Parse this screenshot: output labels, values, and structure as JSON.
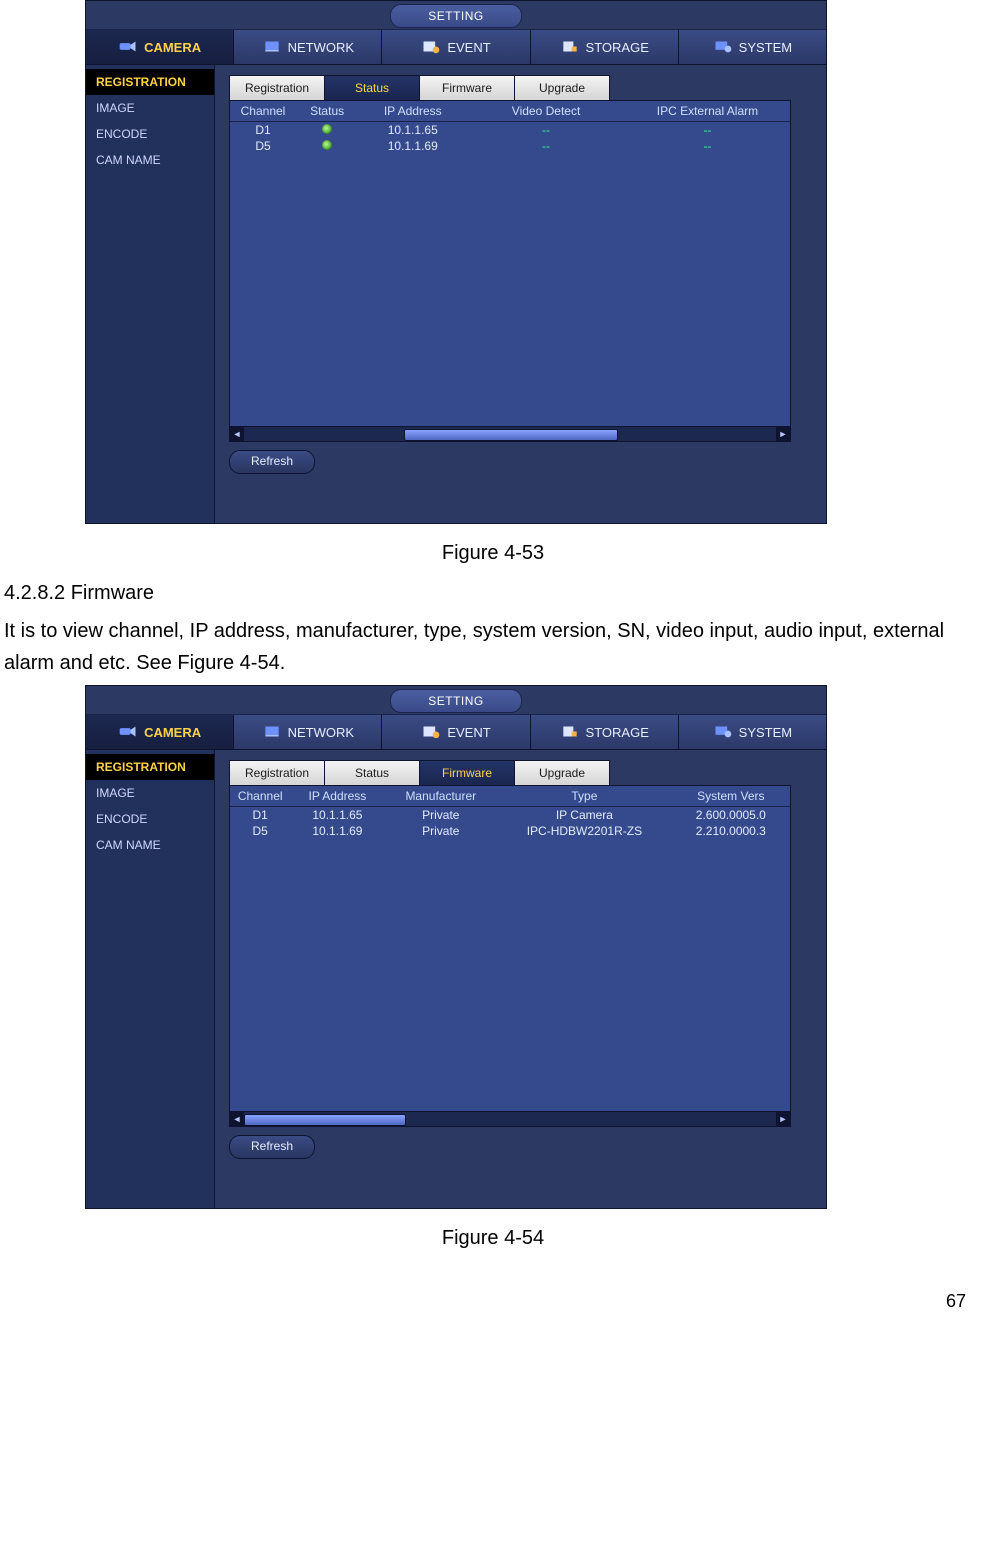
{
  "doc": {
    "fig53": "Figure 4-53",
    "sec_heading": "4.2.8.2 Firmware",
    "sec_body": "It is to view channel, IP address, manufacturer, type, system version, SN, video input, audio input, external alarm and etc. See Figure 4-54.",
    "fig54": "Figure 4-54",
    "pagenum": "67"
  },
  "ui": {
    "title": "SETTING",
    "toptabs": {
      "camera": "CAMERA",
      "network": "NETWORK",
      "event": "EVENT",
      "storage": "STORAGE",
      "system": "SYSTEM"
    },
    "sidebar": {
      "registration": "REGISTRATION",
      "image": "IMAGE",
      "encode": "ENCODE",
      "camname": "CAM NAME"
    },
    "subtabs": {
      "registration": "Registration",
      "status": "Status",
      "firmware": "Firmware",
      "upgrade": "Upgrade"
    },
    "refresh": "Refresh"
  },
  "panel1": {
    "headers": {
      "channel": "Channel",
      "status": "Status",
      "ip": "IP Address",
      "video": "Video Detect",
      "ext": "IPC External Alarm"
    },
    "rows": [
      {
        "channel": "D1",
        "ip": "10.1.1.65",
        "video": "--",
        "ext": "--"
      },
      {
        "channel": "D5",
        "ip": "10.1.1.69",
        "video": "--",
        "ext": "--"
      }
    ]
  },
  "panel2": {
    "headers": {
      "channel": "Channel",
      "ip": "IP Address",
      "mfr": "Manufacturer",
      "type": "Type",
      "sys": "System Vers"
    },
    "rows": [
      {
        "channel": "D1",
        "ip": "10.1.1.65",
        "mfr": "Private",
        "type": "IP Camera",
        "sys": "2.600.0005.0"
      },
      {
        "channel": "D5",
        "ip": "10.1.1.69",
        "mfr": "Private",
        "type": "IPC-HDBW2201R-ZS",
        "sys": "2.210.0000.3"
      }
    ]
  }
}
